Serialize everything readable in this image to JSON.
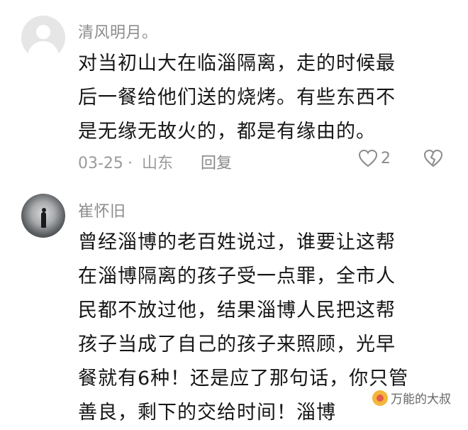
{
  "comments": [
    {
      "username": "清风明月。",
      "lines": [
        "对当初山大在临淄隔离，走的时候最",
        "后一餐给他们送的烧烤。有些东西不",
        "是无缘无故火的，都是有缘由的。"
      ],
      "date": "03-25",
      "location": "山东",
      "reply_label": "回复",
      "like_count": "2"
    },
    {
      "username": "崔怀旧",
      "lines": [
        "曾经淄博的老百姓说过，谁要让这帮",
        "在淄博隔离的孩子受一点罪，全市人",
        "民都不放过他，结果淄博人民把这帮",
        "孩子当成了自己的孩子来照顾，光早",
        "餐就有6种！还是应了那句话，你只管",
        "善良，剩下的交给时间！淄博"
      ]
    }
  ],
  "watermark": {
    "text": "万能的大叔"
  },
  "icons": {
    "like": "heart-outline-icon",
    "dislike": "broken-heart-icon"
  },
  "colors": {
    "text": "#161616",
    "meta": "#9a9a9a",
    "username": "#8c8c8c"
  }
}
